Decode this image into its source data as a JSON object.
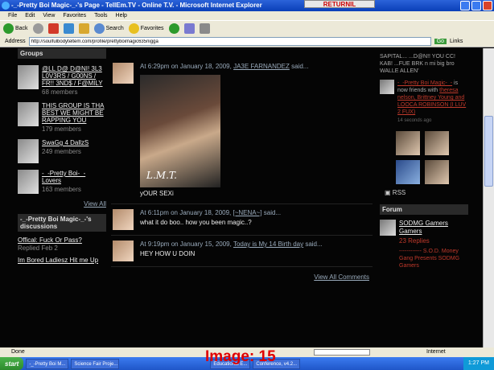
{
  "window": {
    "title": "-_-Pretty Boi Magic-_-'s Page - TellEm.TV - Online T.V. - Microsoft Internet Explorer",
    "returnil_label": "RETURNIL"
  },
  "menu": [
    "File",
    "Edit",
    "View",
    "Favorites",
    "Tools",
    "Help"
  ],
  "toolbar": {
    "back_label": "Back",
    "search_label": "Search",
    "favorites_label": "Favorites"
  },
  "address": {
    "label": "Address",
    "url": "http://soulfulbodyteltem.com/profile/prettyboimagic635nigga",
    "go_label": "Go",
    "links_label": "Links"
  },
  "left": {
    "groups_header": "Groups",
    "groups": [
      {
        "name": "@LL D@ D@NI! 3L3 L0V3RS / G00NS / FR!! 3ND$ / F@MILY",
        "count": "68 members"
      },
      {
        "name": "THIS GROUP IS THA BEST WE MIGHT BE RAPPING YOU",
        "count": "179 members"
      },
      {
        "name": "SwaGg 4 DallzS",
        "count": "249 members"
      },
      {
        "name": "-_-Pretty Boi-_- Lovers",
        "count": "163 members"
      }
    ],
    "view_all": "View All",
    "discussions_header": "-_-Pretty Boi Magic-_-'s discussions",
    "discussions": [
      {
        "title": "Offical: Fuck Or Pass?",
        "meta": "Replied Feb 2"
      },
      {
        "title": "Im Bored Ladiesz Hit me Up",
        "meta": ""
      }
    ]
  },
  "comments": [
    {
      "time": "At 6:29pm on January 18, 2009,",
      "author": "JA3E FARNANDEZ",
      "said": "said...",
      "caption": "L.M.T.",
      "text": "yOUR SEXi"
    },
    {
      "time": "At 6:11pm on January 18, 2009,",
      "author": "[~NENA~]",
      "said": "said...",
      "text": "what it do boo.. how you been magic..?"
    },
    {
      "time": "At 9:19pm on January 15, 2009,",
      "author": "Today is My 14 Birth day",
      "said": "said...",
      "text": "HEY HOW U DOIN"
    }
  ],
  "view_all_comments": "View All Comments",
  "right": {
    "feed_top": "SAPITAL... ...D@N!! YOU CC! KAB! ...FUE BRK n mi big bro WALLE ALLEN'",
    "feed_user": "-_-Pretty Boi Magic-_-",
    "feed_action": "is now friends with",
    "feed_friends": "theresa nelson, Brittney Young and LOOCA ROBINSON (I LUV 2 FUX)",
    "feed_time": "14 seconds ago",
    "rss": "RSS",
    "forum_header": "Forum",
    "forum_title": "SODMG Gamers Gamers",
    "forum_replies": "23 Replies",
    "forum_sub": "------------ S.O.D. Money Gang Presents SODMG Gamers"
  },
  "status": {
    "text": "Done",
    "zone": "Internet"
  },
  "taskbar": {
    "start": "start",
    "tasks": [
      "-_-Pretty Boi M...",
      "Science Fair Proje...",
      "Educational E...",
      "Conference, v4.2..."
    ],
    "clock": "1:27 PM"
  },
  "overlay_label": "Image: 15"
}
